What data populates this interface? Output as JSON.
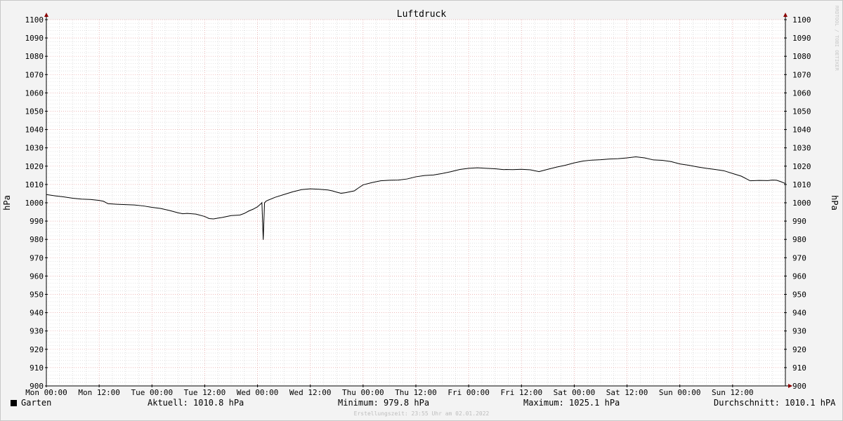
{
  "chart_data": {
    "type": "line",
    "title": "Luftdruck",
    "ylabel": "hPa",
    "ylabel_right": "hPa",
    "ylim": [
      900,
      1100
    ],
    "y_ticks": [
      900,
      910,
      920,
      930,
      940,
      950,
      960,
      970,
      980,
      990,
      1000,
      1010,
      1020,
      1030,
      1040,
      1050,
      1060,
      1070,
      1080,
      1090,
      1100
    ],
    "x_ticks": [
      "Mon 00:00",
      "Mon 12:00",
      "Tue 00:00",
      "Tue 12:00",
      "Wed 00:00",
      "Wed 12:00",
      "Thu 00:00",
      "Thu 12:00",
      "Fri 00:00",
      "Fri 12:00",
      "Sat 00:00",
      "Sat 12:00",
      "Sun 00:00",
      "Sun 12:00"
    ],
    "xlim_hours": [
      0,
      168
    ],
    "grid": true,
    "series": [
      {
        "name": "Garten",
        "color": "#000000",
        "x_hours": [
          0,
          2,
          4,
          6,
          8,
          10,
          12,
          13,
          14,
          16,
          18,
          20,
          22,
          24,
          26,
          28,
          30,
          31,
          32,
          34,
          36,
          37,
          38,
          39,
          40,
          42,
          44,
          45,
          46,
          47,
          48,
          48.8,
          49,
          49.3,
          49.6,
          50,
          52,
          54,
          56,
          58,
          60,
          62,
          64,
          65,
          66,
          67,
          68,
          70,
          71,
          72,
          74,
          76,
          78,
          80,
          82,
          84,
          86,
          88,
          90,
          92,
          94,
          96,
          98,
          100,
          102,
          104,
          104.5,
          106,
          108,
          110,
          112,
          114,
          116,
          118,
          120,
          122,
          124,
          126,
          128,
          130,
          132,
          134,
          136,
          138,
          140,
          142,
          144,
          146,
          148,
          150,
          152,
          154,
          156,
          158,
          160,
          162,
          164,
          165,
          166,
          167,
          168
        ],
        "values": [
          1004.5,
          1003.8,
          1003.2,
          1002.5,
          1002,
          1001.8,
          1001.3,
          1000.8,
          999.5,
          999.2,
          999,
          998.8,
          998.3,
          997.5,
          996.9,
          995.8,
          994.5,
          994,
          994.2,
          993.8,
          992.5,
          991.4,
          991.2,
          991.6,
          992,
          993,
          993.3,
          994.2,
          995.5,
          996.5,
          997.8,
          999.5,
          1000.1,
          979.8,
          1000,
          1001,
          1003,
          1004.5,
          1006,
          1007.2,
          1007.6,
          1007.4,
          1007,
          1006.5,
          1005.8,
          1005.2,
          1005.5,
          1006.5,
          1008.2,
          1009.8,
          1011,
          1012,
          1012.3,
          1012.4,
          1013,
          1014.2,
          1014.9,
          1015.2,
          1016,
          1017,
          1018.2,
          1018.8,
          1019.1,
          1018.8,
          1018.6,
          1018.1,
          1018.2,
          1018.1,
          1018.3,
          1018,
          1017,
          1018.3,
          1019.5,
          1020.5,
          1021.8,
          1022.8,
          1023.3,
          1023.5,
          1023.9,
          1024.1,
          1024.5,
          1025.1,
          1024.5,
          1023.4,
          1023.2,
          1022.5,
          1021.2,
          1020.5,
          1019.6,
          1018.8,
          1018.2,
          1017.5,
          1016,
          1014.5,
          1012,
          1012.2,
          1012.1,
          1012.4,
          1012.3,
          1011.5,
          1010.5,
          1009.8,
          1010.2,
          1010.8
        ]
      }
    ]
  },
  "legend": {
    "series_name": "Garten",
    "current": "Aktuell: 1010.8 hPa",
    "minimum": "Minimum: 979.8 hPa",
    "maximum": "Maximum: 1025.1 hPa",
    "average": "Durchschnitt: 1010.1 hPA"
  },
  "footer": "Erstellungszeit: 23:55 Uhr am 02.01.2022",
  "watermark": "RRDTOOL / TOBI OETIKER",
  "colors": {
    "major_grid": "#e6a0a0",
    "minor_grid": "#d0d0d0",
    "axis": "#000000",
    "arrow": "#8b0000",
    "line": "#000000",
    "plot_bg": "#ffffff"
  }
}
